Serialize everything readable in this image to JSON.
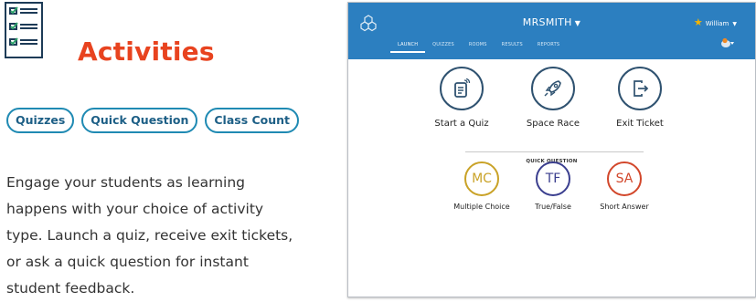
{
  "feature": {
    "icon": "checklist-icon",
    "title": "Activities",
    "tags": [
      "Quizzes",
      "Quick Question",
      "Class Count"
    ],
    "description": "Engage your students as learning happens with your choice of activity type. Launch a quiz, receive exit tickets, or ask a quick question for instant student feedback.",
    "colors": {
      "title": "#e8431f",
      "tag_border": "#1f8ab3",
      "tag_text": "#1d5f86"
    }
  },
  "app": {
    "header": {
      "logo": "hexagon-logo-icon",
      "teacher": "MRSMITH",
      "user_name": "William",
      "tabs": [
        "LAUNCH",
        "QUIZZES",
        "ROOMS",
        "RESULTS",
        "REPORTS"
      ],
      "active_tab": "LAUNCH",
      "color": "#2c7fc0"
    },
    "activities": [
      {
        "label": "Start a Quiz",
        "icon": "quiz-document-icon"
      },
      {
        "label": "Space Race",
        "icon": "rocket-icon"
      },
      {
        "label": "Exit Ticket",
        "icon": "exit-door-icon"
      }
    ],
    "quick_question": {
      "heading": "QUICK QUESTION",
      "options": [
        {
          "abbr": "MC",
          "label": "Multiple Choice",
          "color": "#c9a227"
        },
        {
          "abbr": "TF",
          "label": "True/False",
          "color": "#3b3f8f"
        },
        {
          "abbr": "SA",
          "label": "Short Answer",
          "color": "#d2472b"
        }
      ]
    }
  }
}
